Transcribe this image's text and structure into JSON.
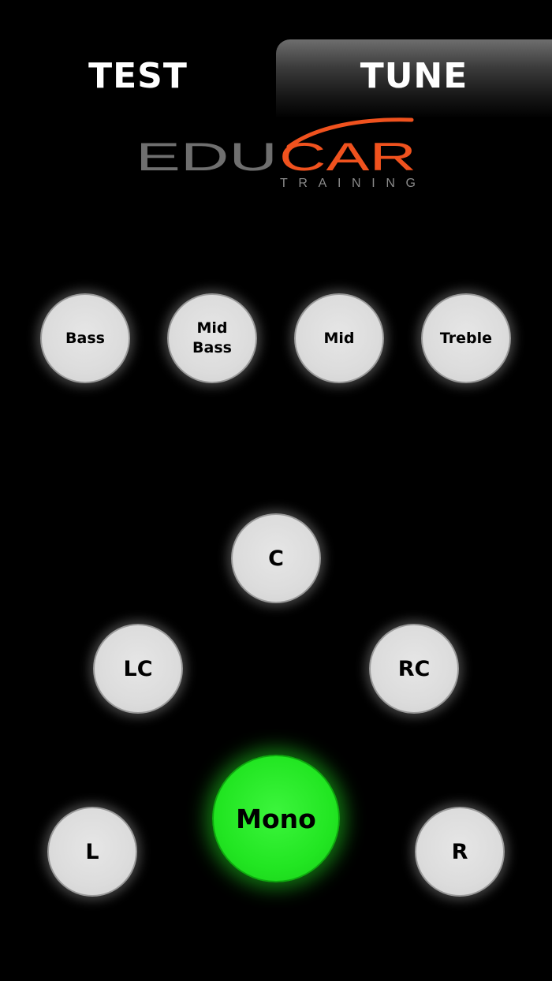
{
  "tabs": {
    "test": "TEST",
    "tune": "TUNE"
  },
  "logo": {
    "edu": "EDU",
    "car": "CAR",
    "training": "TRAINING",
    "colors": {
      "edu": "#6f6f6f",
      "car": "#f0521e"
    }
  },
  "bands": {
    "bass": "Bass",
    "mid_bass_line1": "Mid",
    "mid_bass_line2": "Bass",
    "mid": "Mid",
    "treble": "Treble"
  },
  "channels": {
    "c": "C",
    "lc": "LC",
    "rc": "RC",
    "l": "L",
    "r": "R",
    "mono": "Mono"
  },
  "colors": {
    "active": "#22e622",
    "button": "#dcdcdc",
    "background": "#000000"
  },
  "state": {
    "selected_tab": "TUNE",
    "active_channel": "Mono"
  }
}
